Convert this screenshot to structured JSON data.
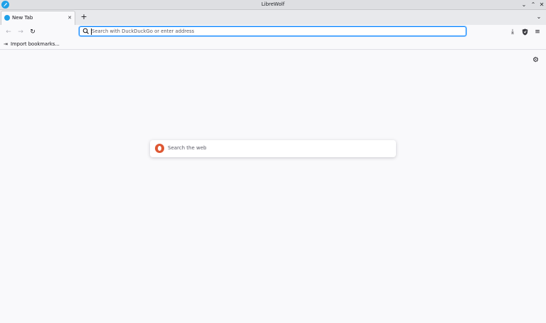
{
  "window": {
    "title": "LibreWolf",
    "minimize_glyph": "⌄",
    "maximize_glyph": "⌃",
    "close_glyph": "✕"
  },
  "tabs": [
    {
      "label": "New Tab",
      "close_glyph": "✕"
    }
  ],
  "tabstrip": {
    "new_tab_glyph": "+",
    "list_tabs_glyph": "⌄"
  },
  "navbar": {
    "back_glyph": "←",
    "forward_glyph": "→",
    "reload_glyph": "↻",
    "url_placeholder": "Search with DuckDuckGo or enter address",
    "download_glyph": "⤓",
    "menu_glyph": "≡"
  },
  "bookmarks": {
    "import_label": "Import bookmarks...",
    "import_glyph": "⇥"
  },
  "newtab": {
    "settings_glyph": "⚙",
    "search_placeholder": "Search the web"
  },
  "icons": [
    "app-logo",
    "tab-favicon",
    "search-icon",
    "back-icon",
    "forward-icon",
    "reload-icon",
    "download-icon",
    "shield-icon",
    "menu-icon",
    "import-icon",
    "gear-icon",
    "duckduckgo-icon"
  ],
  "colors": {
    "accent": "#0a84ff",
    "librewolf_blue": "#1ea0e8",
    "duckduckgo": "#de5833",
    "background": "#f9f9fb"
  }
}
